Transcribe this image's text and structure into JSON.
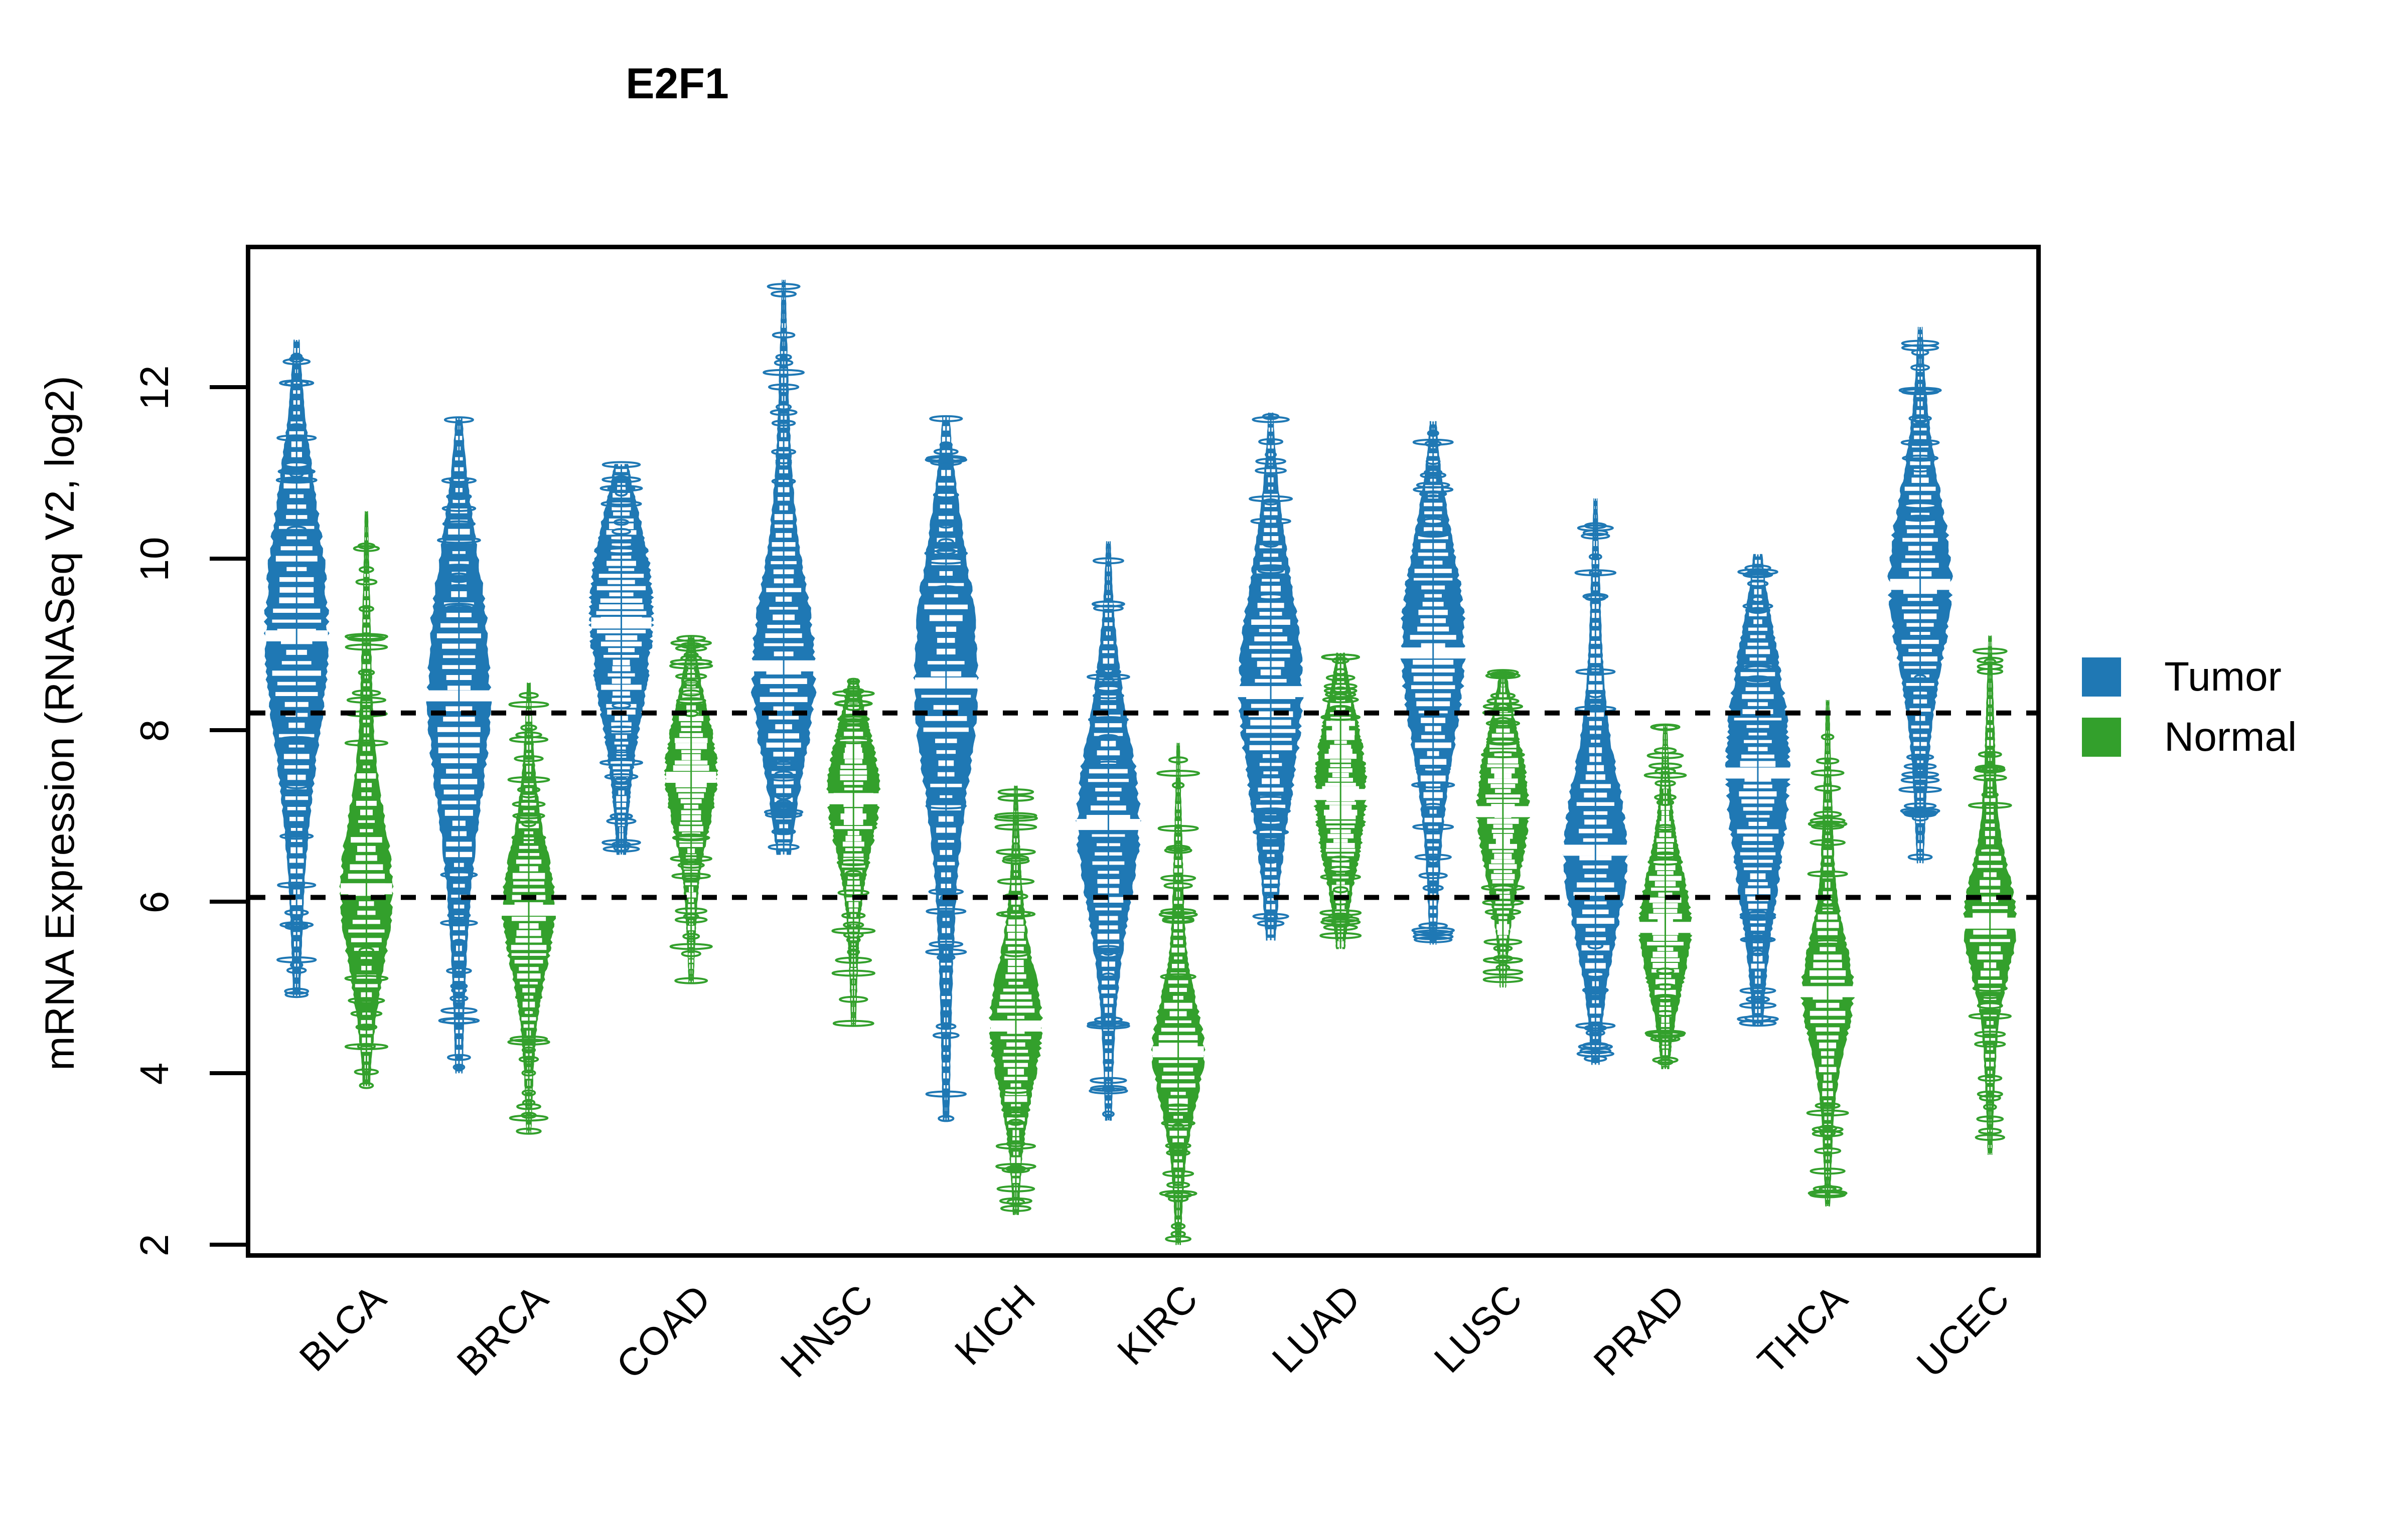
{
  "chart_data": {
    "type": "violin",
    "title": "E2F1",
    "xlabel": "",
    "ylabel": "mRNA Expression (RNASeq V2, log2)",
    "ylim": [
      2,
      13.6
    ],
    "yticks": [
      2,
      4,
      6,
      8,
      10,
      12
    ],
    "ytick_labels": [
      "2",
      "4",
      "6",
      "8",
      "10",
      "12"
    ],
    "grid": false,
    "reference_lines": [
      8.2,
      6.05
    ],
    "legend_position": "right",
    "categories": [
      "BLCA",
      "BRCA",
      "COAD",
      "HNSC",
      "KICH",
      "KIRC",
      "LUAD",
      "LUSC",
      "PRAD",
      "THCA",
      "UCEC"
    ],
    "series": [
      {
        "name": "Tumor",
        "color": "#1F78B4",
        "medians": [
          9.1,
          8.4,
          9.25,
          8.75,
          8.55,
          6.9,
          8.45,
          8.9,
          6.6,
          7.5,
          9.7
        ],
        "q1": [
          7.95,
          7.15,
          8.35,
          7.85,
          7.3,
          6.05,
          7.45,
          8.05,
          5.95,
          6.45,
          8.75
        ],
        "q3": [
          10.05,
          9.25,
          9.9,
          9.45,
          9.3,
          7.6,
          9.25,
          9.7,
          7.35,
          8.3,
          10.25
        ],
        "min": [
          4.9,
          4.0,
          6.55,
          6.55,
          3.45,
          3.45,
          5.55,
          5.5,
          4.1,
          4.55,
          6.45
        ],
        "max": [
          12.55,
          11.65,
          11.1,
          13.25,
          11.65,
          10.2,
          11.7,
          11.6,
          10.7,
          10.05,
          12.7
        ]
      },
      {
        "name": "Normal",
        "color": "#33A02C",
        "medians": [
          6.15,
          5.9,
          7.45,
          7.2,
          4.55,
          4.25,
          7.25,
          7.05,
          5.7,
          4.95,
          5.75
        ],
        "q1": [
          5.6,
          5.4,
          7.0,
          6.75,
          4.0,
          3.85,
          6.7,
          6.55,
          5.25,
          4.55,
          5.35
        ],
        "q3": [
          6.95,
          6.45,
          7.95,
          7.7,
          5.05,
          4.75,
          7.85,
          7.6,
          6.25,
          5.45,
          6.25
        ],
        "min": [
          3.85,
          3.3,
          5.05,
          4.55,
          2.35,
          2.0,
          5.45,
          5.0,
          4.05,
          2.45,
          3.05
        ],
        "max": [
          10.55,
          8.55,
          9.1,
          8.6,
          7.35,
          7.85,
          8.9,
          8.7,
          8.05,
          8.35,
          9.1
        ]
      }
    ]
  },
  "legend": {
    "items": [
      {
        "label": "Tumor",
        "color": "#1F78B4"
      },
      {
        "label": "Normal",
        "color": "#33A02C"
      }
    ]
  }
}
